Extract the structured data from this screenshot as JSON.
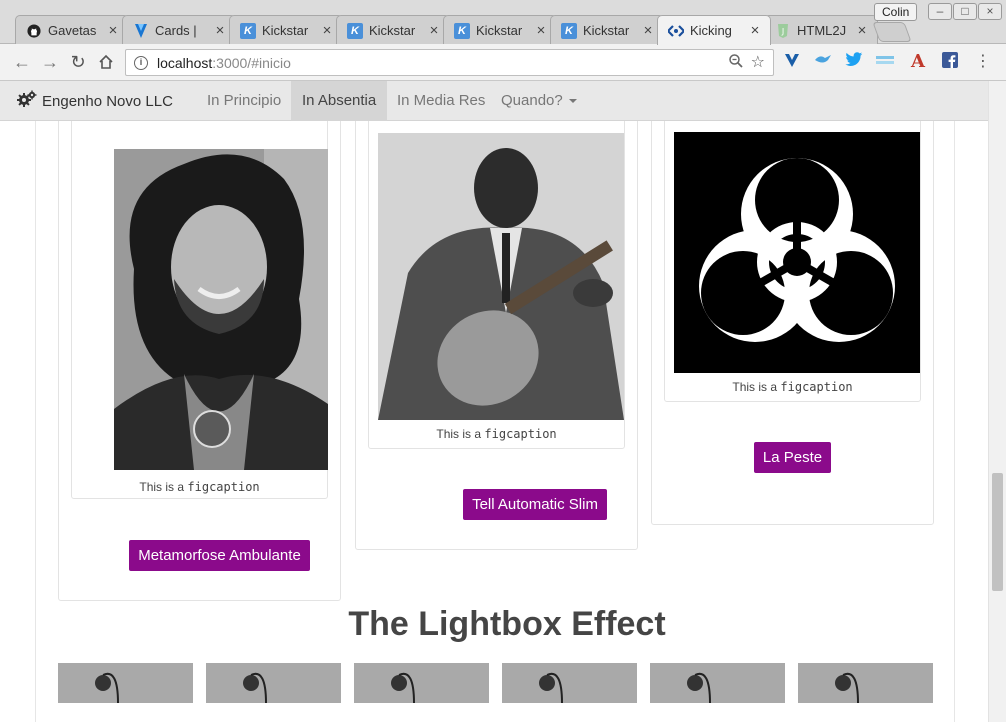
{
  "browser": {
    "tabs": [
      {
        "title": "Gavetas",
        "favicon": "github-icon"
      },
      {
        "title": "Cards |",
        "favicon": "vuetify-icon"
      },
      {
        "title": "Kickstar",
        "favicon": "kickstart-icon"
      },
      {
        "title": "Kickstar",
        "favicon": "kickstart-icon"
      },
      {
        "title": "Kickstar",
        "favicon": "kickstart-icon"
      },
      {
        "title": "Kickstar",
        "favicon": "kickstart-icon"
      },
      {
        "title": "Kicking",
        "favicon": "code-icon"
      },
      {
        "title": "HTML2J",
        "favicon": "html2j-icon"
      }
    ],
    "active_tab": 6,
    "user": "Colin",
    "url_host": "localhost",
    "url_path": ":3000/#inicio",
    "colors": {
      "tab_active": "#f2f2f2",
      "chrome": "#dcdcdc"
    }
  },
  "navbar": {
    "brand": "Engenho Novo LLC",
    "links": [
      "In Principio",
      "In Absentia",
      "In Media Res",
      "Quando?"
    ],
    "active_link": "In Absentia"
  },
  "cards": [
    {
      "caption_prefix": "This is a",
      "caption_code": "figcaption",
      "button": "Metamorfose Ambulante"
    },
    {
      "caption_prefix": "This is a",
      "caption_code": "figcaption",
      "button": "Tell Automatic Slim"
    },
    {
      "caption_prefix": "This is a",
      "caption_code": "figcaption",
      "button": "La Peste"
    }
  ],
  "section": {
    "title": "The Lightbox Effect"
  },
  "theme": {
    "button_color": "#8b0a8b",
    "heading_color": "#454545"
  }
}
